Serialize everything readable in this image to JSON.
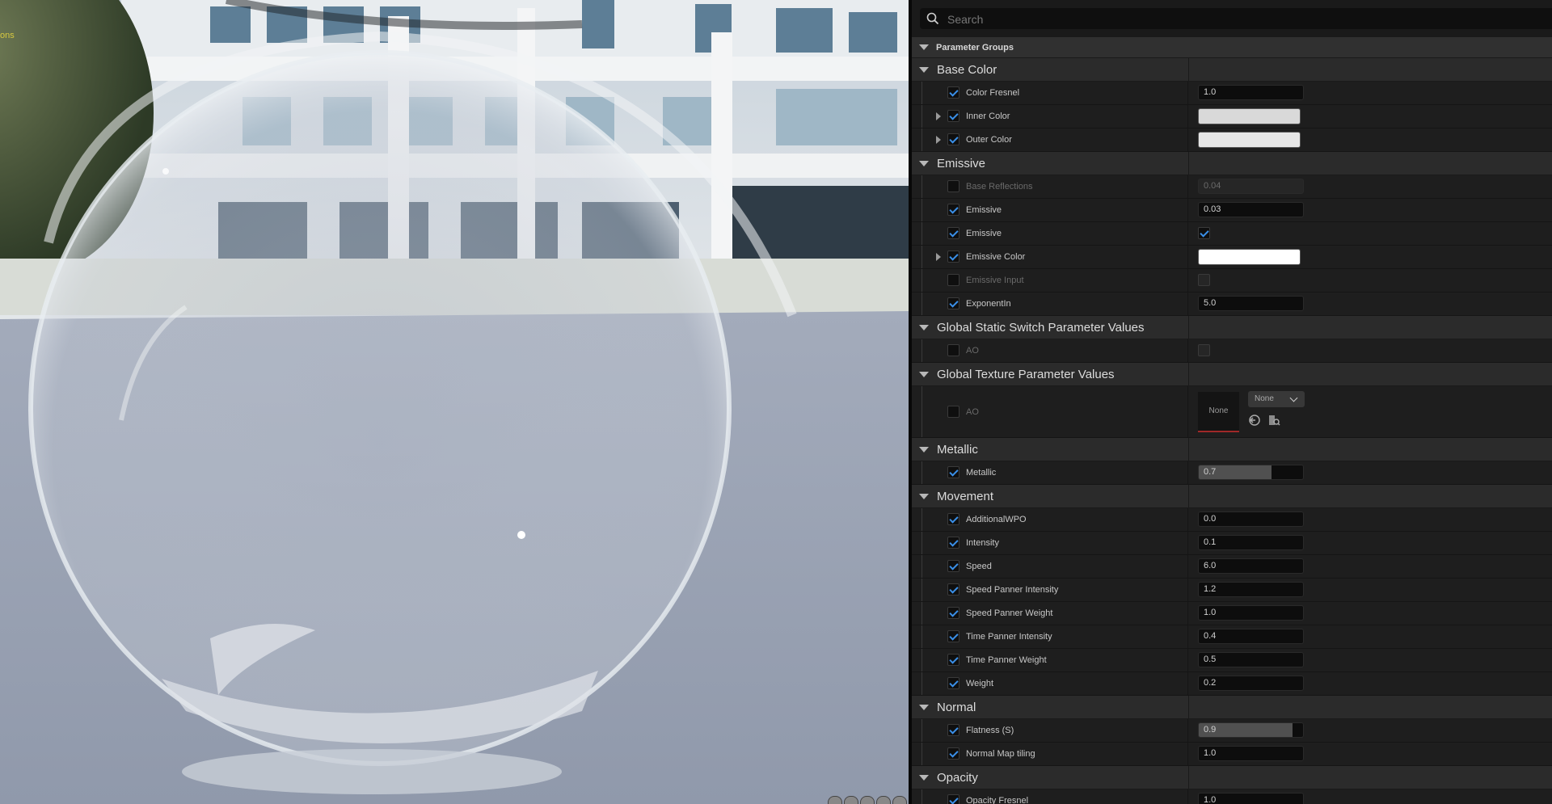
{
  "viewport": {
    "corner_label": "ons"
  },
  "search": {
    "placeholder": "Search"
  },
  "panel": {
    "root_header": "Parameter Groups",
    "groups": [
      {
        "title": "Base Color",
        "rows": [
          {
            "label": "Color Fresnel",
            "enabled": true,
            "type": "number",
            "value": "1.0"
          },
          {
            "label": "Inner Color",
            "enabled": true,
            "type": "color",
            "color": "#d9d9d9",
            "expandable": true
          },
          {
            "label": "Outer Color",
            "enabled": true,
            "type": "color",
            "color": "#e6e6e6",
            "expandable": true
          }
        ]
      },
      {
        "title": "Emissive",
        "rows": [
          {
            "label": "Base Reflections",
            "enabled": false,
            "type": "number",
            "value": "0.04"
          },
          {
            "label": "Emissive",
            "enabled": true,
            "type": "number",
            "value": "0.03"
          },
          {
            "label": "Emissive",
            "enabled": true,
            "type": "bool",
            "checked": true
          },
          {
            "label": "Emissive Color",
            "enabled": true,
            "type": "color",
            "color": "#ffffff",
            "expandable": true
          },
          {
            "label": "Emissive Input",
            "enabled": false,
            "type": "bool",
            "checked": false
          },
          {
            "label": "ExponentIn",
            "enabled": true,
            "type": "number",
            "value": "5.0"
          }
        ]
      },
      {
        "title": "Global Static Switch Parameter Values",
        "rows": [
          {
            "label": "AO",
            "enabled": false,
            "type": "bool",
            "checked": false
          }
        ]
      },
      {
        "title": "Global Texture Parameter Values",
        "rows": [
          {
            "label": "AO",
            "enabled": false,
            "type": "texture",
            "thumb": "None",
            "combo": "None"
          }
        ]
      },
      {
        "title": "Metallic",
        "rows": [
          {
            "label": "Metallic",
            "enabled": true,
            "type": "slider",
            "value": "0.7",
            "fraction": 0.7
          }
        ]
      },
      {
        "title": "Movement",
        "rows": [
          {
            "label": "AdditionalWPO",
            "enabled": true,
            "type": "number",
            "value": "0.0"
          },
          {
            "label": "Intensity",
            "enabled": true,
            "type": "number",
            "value": "0.1"
          },
          {
            "label": "Speed",
            "enabled": true,
            "type": "number",
            "value": "6.0"
          },
          {
            "label": "Speed Panner Intensity",
            "enabled": true,
            "type": "number",
            "value": "1.2"
          },
          {
            "label": "Speed Panner Weight",
            "enabled": true,
            "type": "number",
            "value": "1.0"
          },
          {
            "label": "Time Panner Intensity",
            "enabled": true,
            "type": "number",
            "value": "0.4"
          },
          {
            "label": "Time Panner Weight",
            "enabled": true,
            "type": "number",
            "value": "0.5"
          },
          {
            "label": "Weight",
            "enabled": true,
            "type": "number",
            "value": "0.2"
          }
        ]
      },
      {
        "title": "Normal",
        "rows": [
          {
            "label": "Flatness (S)",
            "enabled": true,
            "type": "slider",
            "value": "0.9",
            "fraction": 0.9
          },
          {
            "label": "Normal Map tiling",
            "enabled": true,
            "type": "number",
            "value": "1.0"
          }
        ]
      },
      {
        "title": "Opacity",
        "rows": [
          {
            "label": "Opacity Fresnel",
            "enabled": true,
            "type": "number",
            "value": "1.0"
          }
        ]
      }
    ]
  },
  "colors": {
    "accent": "#3a8fe8",
    "panel_bg": "#242424",
    "row_bg": "#1e1e1e",
    "header_bg": "#2b2b2b"
  }
}
